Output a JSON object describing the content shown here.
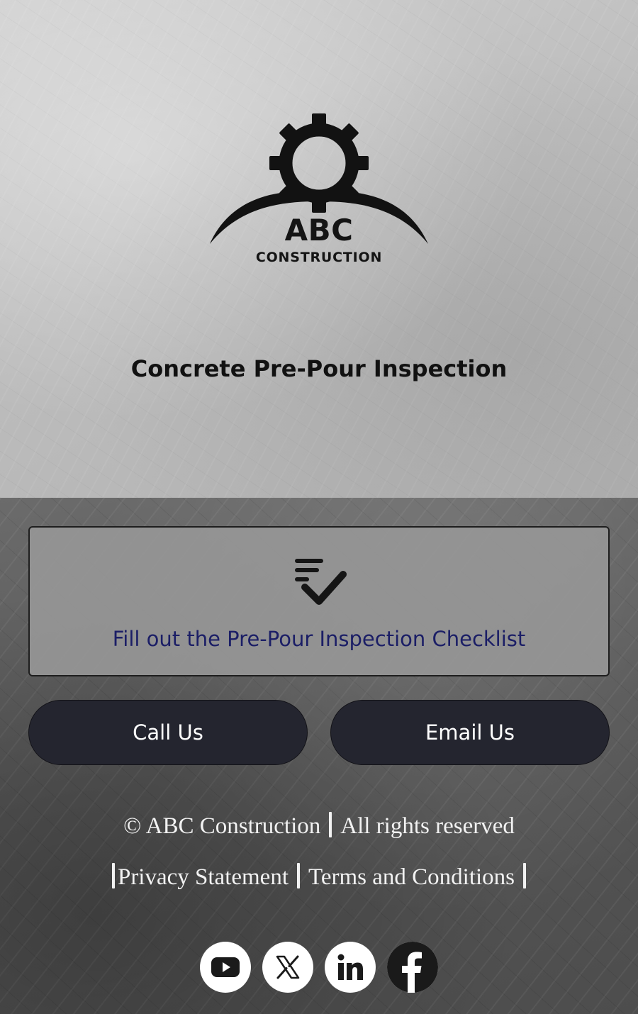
{
  "logo": {
    "name": "ABC",
    "subtitle": "CONSTRUCTION"
  },
  "page_title": "Concrete Pre-Pour Inspection",
  "checklist": {
    "icon": "checklist-icon",
    "label": "Fill out the Pre-Pour Inspection Checklist"
  },
  "buttons": {
    "call": "Call Us",
    "email": "Email Us"
  },
  "footer": {
    "copyright": "© ABC Construction",
    "rights": "All rights reserved",
    "privacy": "Privacy Statement",
    "terms": "Terms and Conditions"
  },
  "socials": [
    {
      "icon": "youtube-icon"
    },
    {
      "icon": "x-icon"
    },
    {
      "icon": "linkedin-icon"
    },
    {
      "icon": "facebook-icon"
    }
  ],
  "colors": {
    "button_bg": "#24252f",
    "checklist_text": "#1b1e66",
    "card_bg": "#969696"
  }
}
